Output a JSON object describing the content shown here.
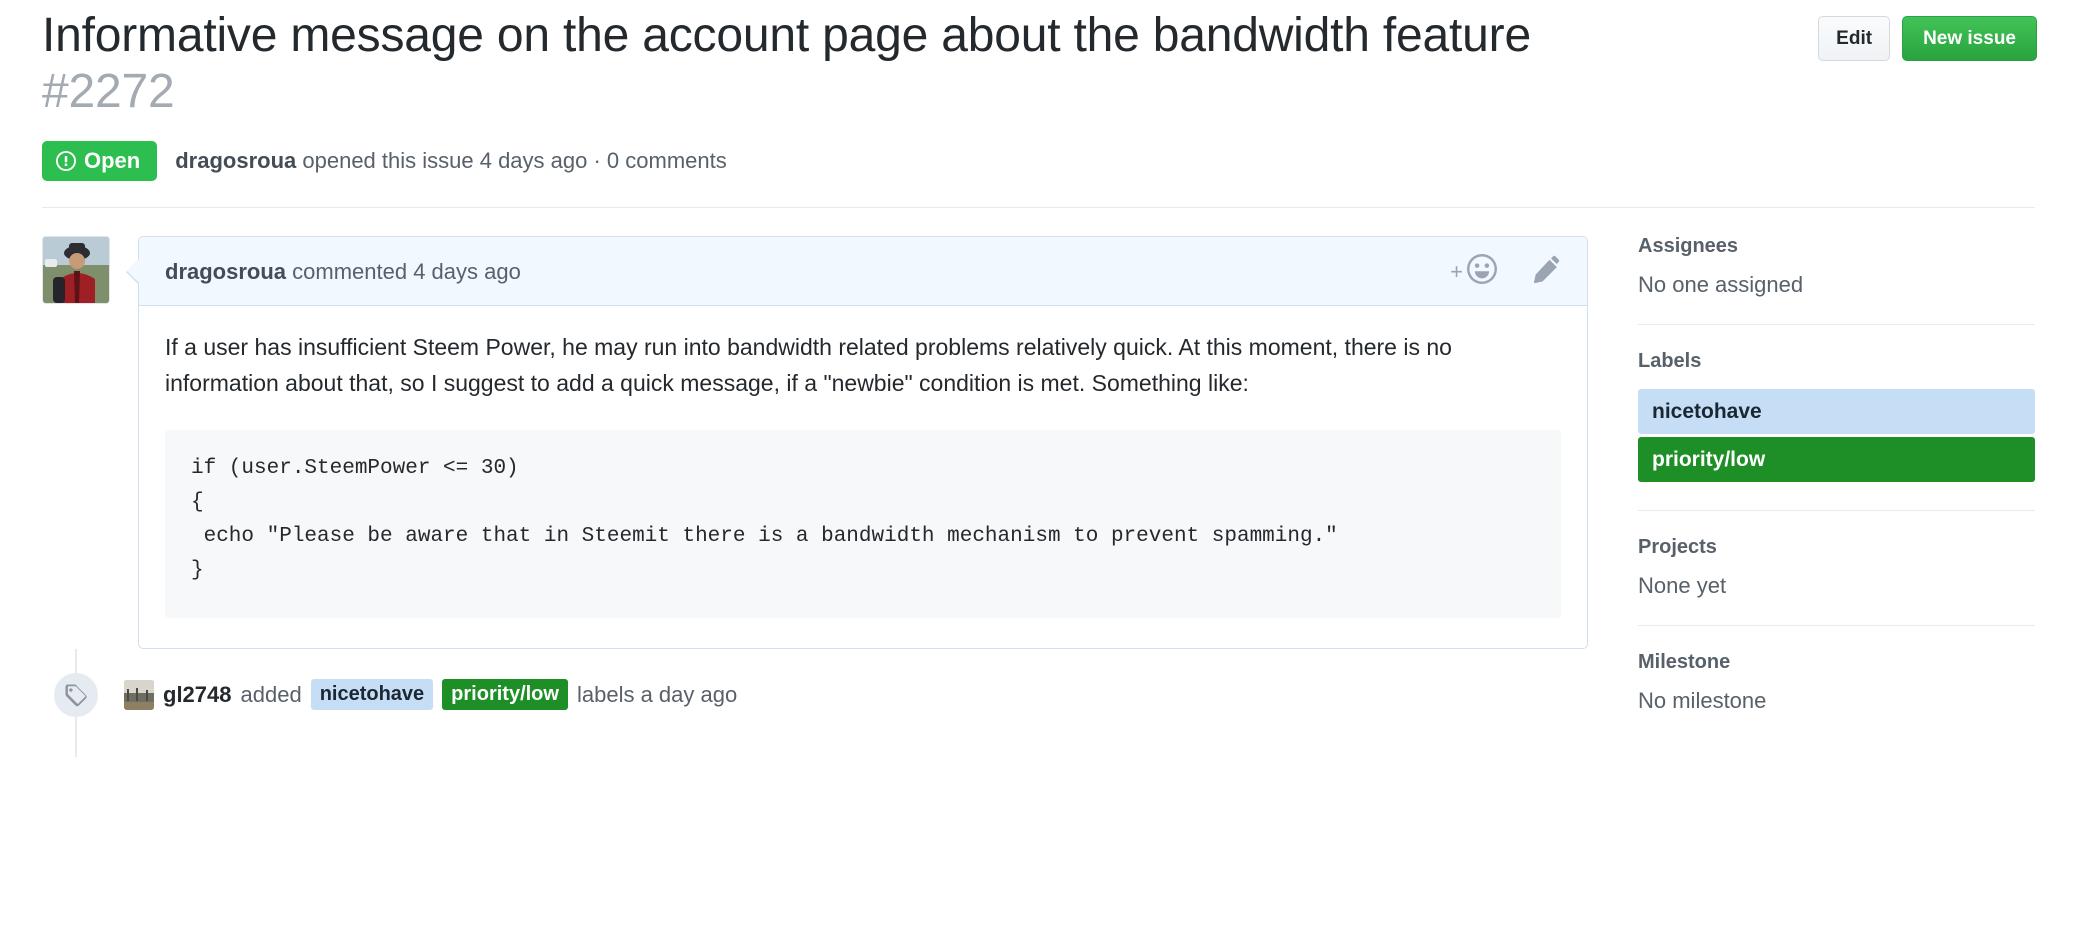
{
  "header": {
    "title": "Informative message on the account page about the bandwidth feature",
    "issue_number": "#2272",
    "edit_label": "Edit",
    "new_issue_label": "New issue",
    "state": "Open",
    "meta_author": "dragosroua",
    "meta_opened": " opened this issue 4 days ago · 0 comments"
  },
  "comment": {
    "author": "dragosroua",
    "action": " commented 4 days ago",
    "body": "If a user has insufficient Steem Power, he may run into bandwidth related problems relatively quick. At this moment, there is no information about that, so I suggest to add a quick message, if a \"newbie\" condition is met. Something like:",
    "code": "if (user.SteemPower <= 30)\n{\n echo \"Please be aware that in Steemit there is a bandwidth mechanism to prevent spamming.\"\n}"
  },
  "timeline": {
    "actor": "gl2748",
    "added_text": "added",
    "labels": [
      {
        "name": "nicetohave",
        "bg": "#c5def5",
        "fg": "#1b2733"
      },
      {
        "name": "priority/low",
        "bg": "#1d8f26",
        "fg": "#ffffff"
      }
    ],
    "suffix": "labels a day ago"
  },
  "sidebar": {
    "assignees_title": "Assignees",
    "assignees_value": "No one assigned",
    "labels_title": "Labels",
    "labels": [
      {
        "name": "nicetohave",
        "bg": "#c5def5",
        "fg": "#1b2733"
      },
      {
        "name": "priority/low",
        "bg": "#1d8f26",
        "fg": "#ffffff"
      }
    ],
    "projects_title": "Projects",
    "projects_value": "None yet",
    "milestone_title": "Milestone",
    "milestone_value": "No milestone"
  },
  "colors": {
    "open_green": "#2cbe4e",
    "primary_green": "#29a33e",
    "comment_header_blue": "#f1f8ff",
    "code_bg": "#f6f8fa"
  }
}
